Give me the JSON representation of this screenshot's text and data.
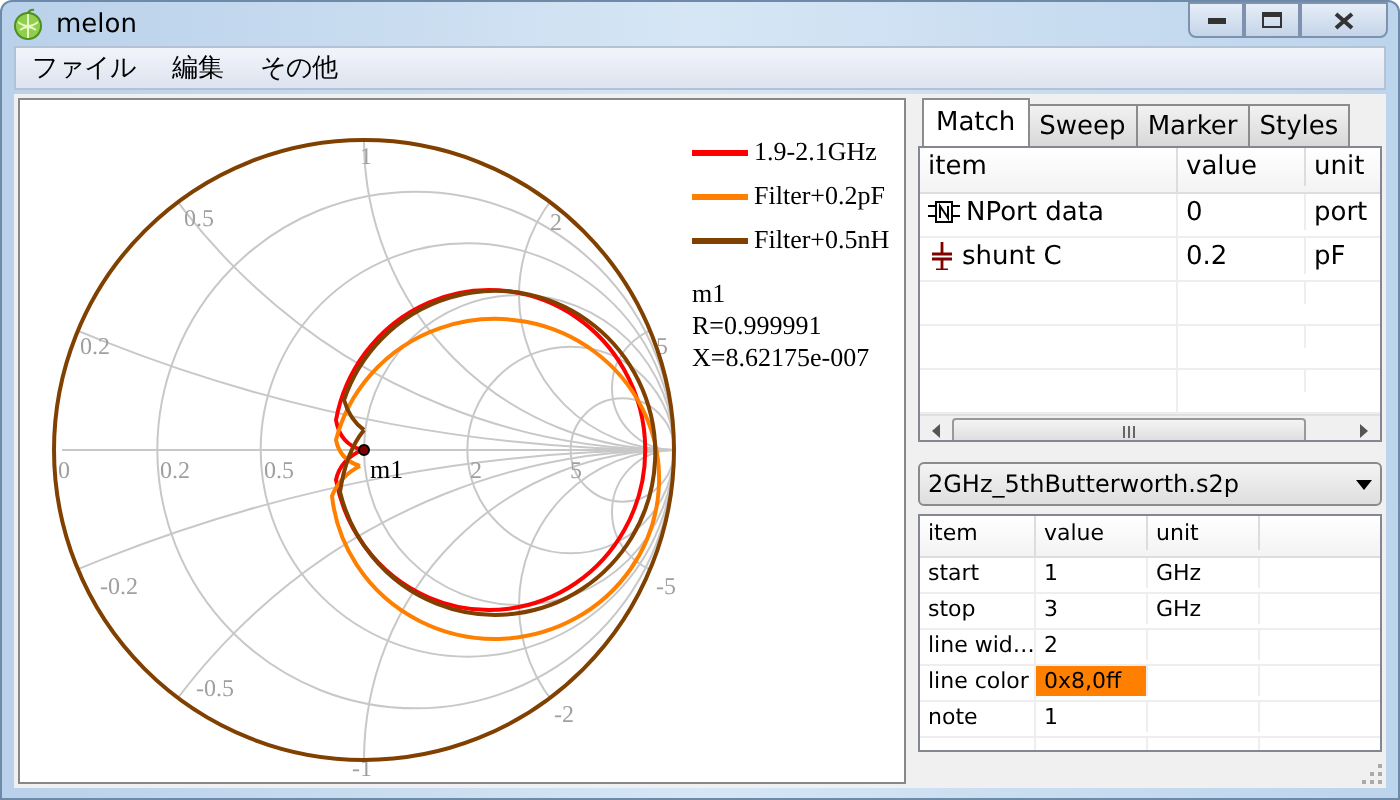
{
  "window": {
    "title": "melon"
  },
  "menu": [
    "ファイル",
    "編集",
    "その他"
  ],
  "chart": {
    "resistance_labels": [
      "0",
      "0.2",
      "0.5",
      "2",
      "5"
    ],
    "reactance_labels": [
      "1",
      "0.5",
      "0.2",
      "2",
      "5",
      "-5",
      "-2",
      "-1",
      "-0.5",
      "-0.2"
    ],
    "legend": [
      {
        "label": "1.9-2.1GHz",
        "color": "#ff0000"
      },
      {
        "label": "Filter+0.2pF",
        "color": "#ff8000"
      },
      {
        "label": "Filter+0.5nH",
        "color": "#804000"
      }
    ],
    "marker": {
      "name": "m1",
      "lines": [
        "m1",
        "R=0.999991",
        "X=8.62175e-007"
      ]
    }
  },
  "tabs": [
    {
      "label": "Match",
      "selected": true
    },
    {
      "label": "Sweep",
      "selected": false
    },
    {
      "label": "Marker",
      "selected": false
    },
    {
      "label": "Styles",
      "selected": false
    }
  ],
  "match_table": {
    "columns": [
      "item",
      "value",
      "unit"
    ],
    "rows": [
      {
        "kind": "nport",
        "item": "NPort data",
        "value": "0",
        "unit": "port"
      },
      {
        "kind": "capacitor",
        "item": "shunt C",
        "value": "0.2",
        "unit": "pF"
      }
    ]
  },
  "file_select": {
    "value": "2GHz_5thButterworth.s2p"
  },
  "property_table": {
    "columns": [
      "item",
      "value",
      "unit"
    ],
    "rows": [
      {
        "item": "start",
        "value": "1",
        "unit": "GHz"
      },
      {
        "item": "stop",
        "value": "3",
        "unit": "GHz"
      },
      {
        "item": "line wid…",
        "value": "2"
      },
      {
        "item": "line color",
        "value": "0x8,0ff",
        "color": "#ff8000"
      },
      {
        "item": "note",
        "value": "1"
      }
    ]
  }
}
